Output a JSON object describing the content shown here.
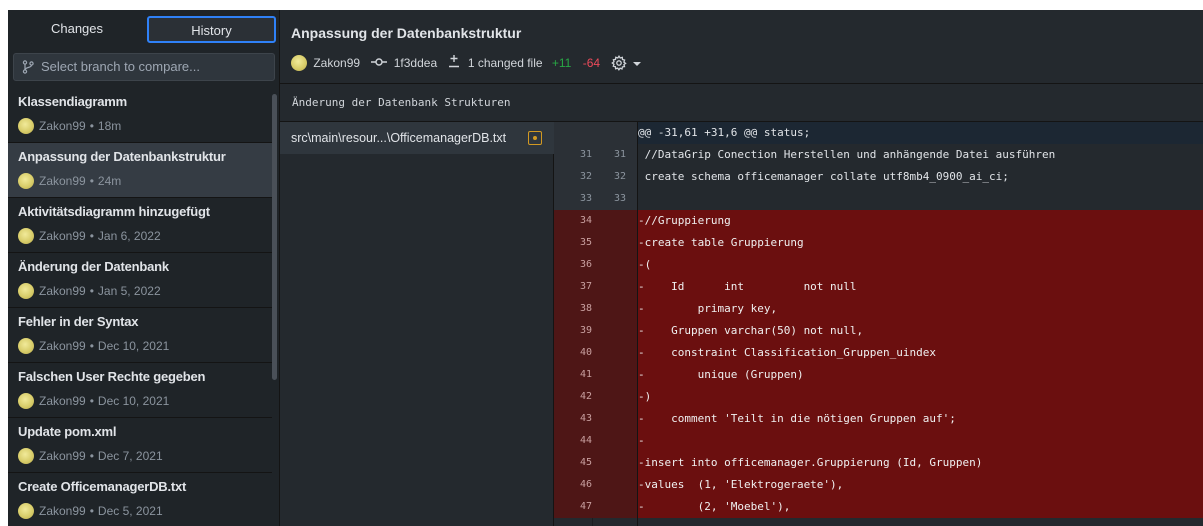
{
  "tabs": {
    "changes": "Changes",
    "history": "History"
  },
  "branch_compare": {
    "placeholder": "Select branch to compare..."
  },
  "commits": [
    {
      "title": "Klassendiagramm",
      "author": "Zakon99",
      "time": "18m"
    },
    {
      "title": "Anpassung der Datenbankstruktur",
      "author": "Zakon99",
      "time": "24m",
      "selected": true
    },
    {
      "title": "Aktivitätsdiagramm hinzugefügt",
      "author": "Zakon99",
      "time": "Jan 6, 2022"
    },
    {
      "title": "Änderung der Datenbank",
      "author": "Zakon99",
      "time": "Jan 5, 2022"
    },
    {
      "title": "Fehler in der Syntax",
      "author": "Zakon99",
      "time": "Dec 10, 2021"
    },
    {
      "title": "Falschen User Rechte gegeben",
      "author": "Zakon99",
      "time": "Dec 10, 2021"
    },
    {
      "title": "Update pom.xml",
      "author": "Zakon99",
      "time": "Dec 7, 2021"
    },
    {
      "title": "Create OfficemanagerDB.txt",
      "author": "Zakon99",
      "time": "Dec 5, 2021"
    }
  ],
  "meta_separator": "•",
  "commit": {
    "title": "Anpassung der Datenbankstruktur",
    "author": "Zakon99",
    "sha": "1f3ddea",
    "changed_files": "1 changed file",
    "additions": "+11",
    "deletions": "-64",
    "description": "Änderung der Datenbank Strukturen"
  },
  "file": {
    "name": "src\\main\\resour...\\OfficemanagerDB.txt",
    "status": "modified"
  },
  "diff": {
    "hunk_header": "@@ -31,61 +31,6 @@ status;",
    "lines": [
      {
        "type": "ctx",
        "old": "31",
        "new": "31",
        "text": " //DataGrip Conection Herstellen und anhängende Datei ausführen"
      },
      {
        "type": "ctx",
        "old": "32",
        "new": "32",
        "text": " create schema officemanager collate utf8mb4_0900_ai_ci;"
      },
      {
        "type": "ctx",
        "old": "33",
        "new": "33",
        "text": ""
      },
      {
        "type": "del",
        "old": "34",
        "new": "",
        "text": "-//Gruppierung"
      },
      {
        "type": "del",
        "old": "35",
        "new": "",
        "text": "-create table Gruppierung"
      },
      {
        "type": "del",
        "old": "36",
        "new": "",
        "text": "-("
      },
      {
        "type": "del",
        "old": "37",
        "new": "",
        "text": "-    Id      int         not null"
      },
      {
        "type": "del",
        "old": "38",
        "new": "",
        "text": "-        primary key,"
      },
      {
        "type": "del",
        "old": "39",
        "new": "",
        "text": "-    Gruppen varchar(50) not null,"
      },
      {
        "type": "del",
        "old": "40",
        "new": "",
        "text": "-    constraint Classification_Gruppen_uindex"
      },
      {
        "type": "del",
        "old": "41",
        "new": "",
        "text": "-        unique (Gruppen)"
      },
      {
        "type": "del",
        "old": "42",
        "new": "",
        "text": "-)"
      },
      {
        "type": "del",
        "old": "43",
        "new": "",
        "text": "-    comment 'Teilt in die nötigen Gruppen auf';"
      },
      {
        "type": "del",
        "old": "44",
        "new": "",
        "text": "-"
      },
      {
        "type": "del",
        "old": "45",
        "new": "",
        "text": "-insert into officemanager.Gruppierung (Id, Gruppen)"
      },
      {
        "type": "del",
        "old": "46",
        "new": "",
        "text": "-values  (1, 'Elektrogeraete'),"
      },
      {
        "type": "del",
        "old": "47",
        "new": "",
        "text": "-        (2, 'Moebel'),"
      }
    ]
  },
  "icons": {
    "branch": "git-branch-icon",
    "commit": "git-commit-icon",
    "diff": "diff-icon",
    "settings": "gear-icon",
    "caret": "caret-down-icon",
    "file_status": "file-modified-icon"
  },
  "colors": {
    "accent": "#2f81f7",
    "additions": "#28a745",
    "deletions": "#ea4a5a",
    "deleted_line_bg": "#6b0f0f",
    "modified_badge": "#d29922"
  }
}
